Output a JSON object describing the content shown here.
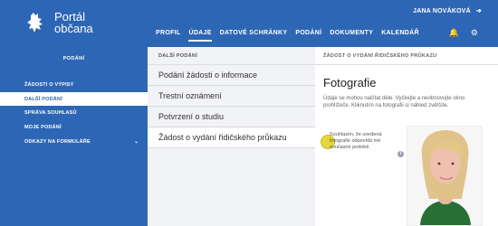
{
  "brand": {
    "title_line1": "Portál",
    "title_line2": "občana",
    "lion_icon": "czech-lion-icon"
  },
  "user": {
    "name": "JANA NOVÁKOVÁ",
    "logout_icon": "logout-icon"
  },
  "nav": [
    "PROFIL",
    "ÚDAJE",
    "DATOVÉ SCHRÁNKY",
    "PODÁNÍ",
    "DOKUMENTY",
    "KALENDÁŘ"
  ],
  "tools": {
    "bell_icon": "bell-icon",
    "settings_icon": "gear-icon"
  },
  "sidebar": {
    "title": "PODÁNÍ",
    "items": [
      {
        "label": "ŽÁDOSTI O VÝPISY"
      },
      {
        "label": "DALŠÍ PODÁNÍ"
      },
      {
        "label": "SPRÁVA SOUHLASŮ"
      },
      {
        "label": "MOJE PODÁNÍ"
      },
      {
        "label": "ODKAZY NA FORMULÁŘE"
      }
    ],
    "chevron": "chevron-down-icon"
  },
  "middle": {
    "title": "DALŠÍ PODÁNÍ",
    "items": [
      "Podání žádosti o informace",
      "Trestní oznámení",
      "Potvrzení o studiu",
      "Žádost o vydání řidičského průkazu"
    ]
  },
  "detail": {
    "title": "ŽÁDOST O VYDÁNÍ ŘIDIČSKÉHO PRŮKAZU",
    "heading": "Fotografie",
    "note": "Údaje se mohou načítat déle. Vyčkejte a neobnovujte okno prohlížeče. Kliknutím na fotografii si náhled zvětšíte.",
    "consent": "Souhlasím, že uvedená fotografie odpovídá mé současné podobě.",
    "info_icon": "info-icon"
  },
  "colors": {
    "primary": "#2d66b5",
    "accent": "#e5d63b"
  }
}
